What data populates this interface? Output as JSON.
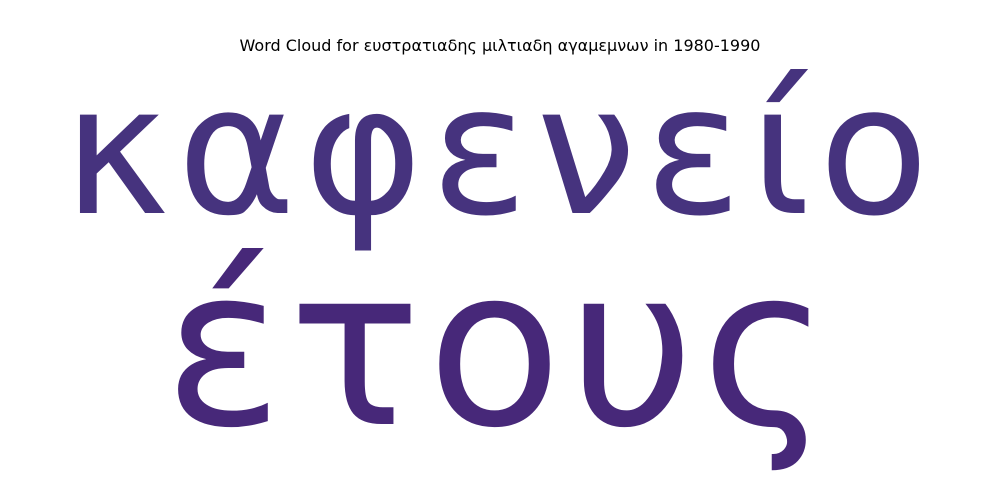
{
  "chart_data": {
    "type": "wordcloud",
    "title": "Word Cloud for ευστρατιαδης μιλτιαδη αγαμεμνων in 1980-1990",
    "words": [
      {
        "text": "καφενείο",
        "color": "#46337e"
      },
      {
        "text": "έτους",
        "color": "#472879"
      }
    ]
  }
}
